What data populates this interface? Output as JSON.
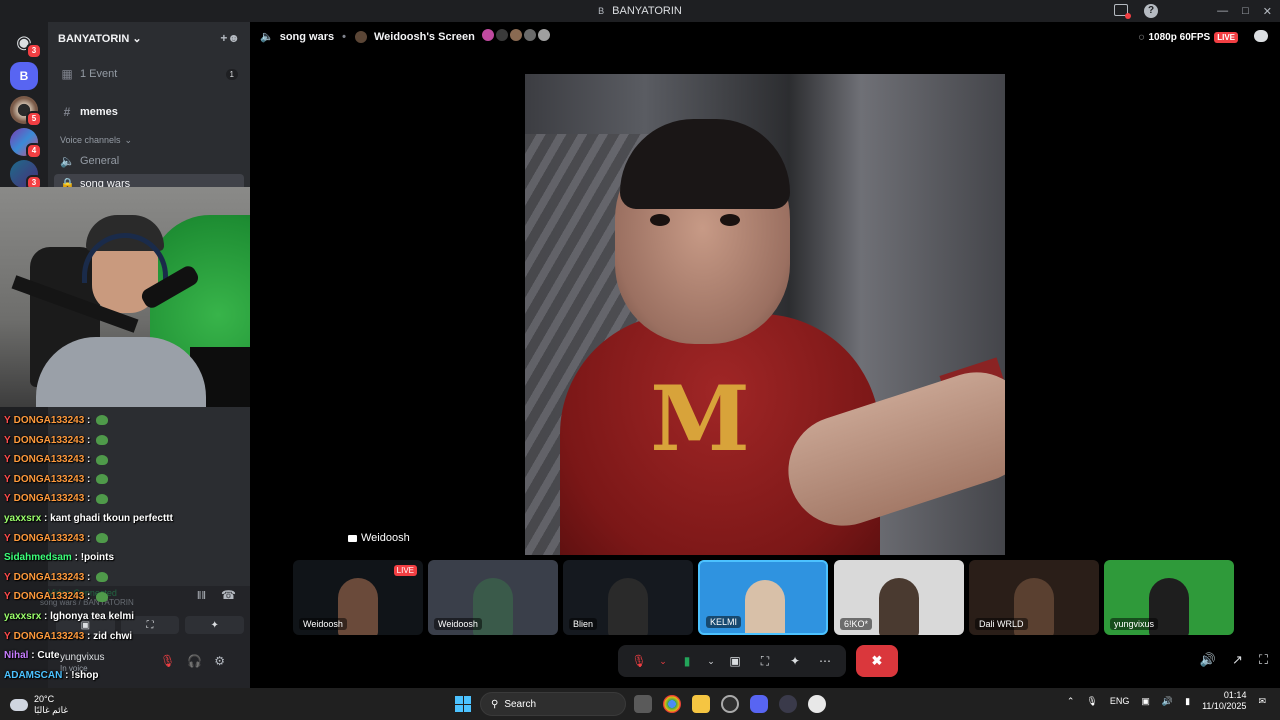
{
  "window": {
    "badge": "B",
    "title": "BANYATORIN"
  },
  "rail": {
    "items": [
      {
        "label": "B",
        "badge": ""
      },
      {
        "label": "",
        "badge": "5"
      },
      {
        "label": "",
        "badge": "4"
      },
      {
        "label": "",
        "badge": "3"
      }
    ],
    "discord_badge": "3"
  },
  "server": {
    "name": "BANYATORIN",
    "events": {
      "label": "1 Event",
      "count": "1"
    },
    "text_channel": "memes",
    "voice_header": "Voice channels",
    "voice_channels": [
      "General",
      "song wars"
    ]
  },
  "chat": [
    {
      "user": "DONGA133243",
      "msg": "",
      "color": "#ff9a3c",
      "emote": true
    },
    {
      "user": "DONGA133243",
      "msg": "",
      "color": "#ff9a3c",
      "emote": true
    },
    {
      "user": "DONGA133243",
      "msg": "",
      "color": "#ff9a3c",
      "emote": true
    },
    {
      "user": "DONGA133243",
      "msg": "",
      "color": "#ff9a3c",
      "emote": true
    },
    {
      "user": "DONGA133243",
      "msg": "",
      "color": "#ff9a3c",
      "emote": true
    },
    {
      "user": "yaxxsrx",
      "msg": "kant ghadi tkoun perfecttt",
      "color": "#9aff6b",
      "emote": false
    },
    {
      "user": "DONGA133243",
      "msg": "",
      "color": "#ff9a3c",
      "emote": true
    },
    {
      "user": "Sidahmedsam",
      "msg": "!points",
      "color": "#3cff7a",
      "emote": false
    },
    {
      "user": "DONGA133243",
      "msg": "",
      "color": "#ff9a3c",
      "emote": true
    },
    {
      "user": "DONGA133243",
      "msg": "",
      "color": "#ff9a3c",
      "emote": true
    },
    {
      "user": "yaxxsrx",
      "msg": "lghonya tea kelmi",
      "color": "#9aff6b",
      "emote": false
    },
    {
      "user": "DONGA133243",
      "msg": "zid chwi",
      "color": "#ff9a3c",
      "emote": false
    },
    {
      "user": "Nihal",
      "msg": "Cute",
      "color": "#c77dff",
      "emote": false
    },
    {
      "user": "ADAMSCAN",
      "msg": "!shop",
      "color": "#4cc2ff",
      "emote": false
    }
  ],
  "voice_panel": {
    "status": "Video Connected",
    "channel": "song wars / BANYATORIN",
    "user": "yungvixus",
    "user_status": "In voice"
  },
  "stage": {
    "channel": "song wars",
    "screen_title": "Weidoosh's Screen",
    "quality": "1080p 60FPS",
    "live": "LIVE",
    "sharer": "Weidoosh"
  },
  "tiles": [
    {
      "name": "Weidoosh",
      "live": "LIVE",
      "bg": "#101418"
    },
    {
      "name": "Weidoosh",
      "live": "",
      "bg": "#3a3f4a"
    },
    {
      "name": "Blien",
      "live": "",
      "bg": "#15191f"
    },
    {
      "name": "KELMI",
      "live": "",
      "bg": "#2f93e0"
    },
    {
      "name": "6!KO*",
      "live": "",
      "bg": "#d9d9d9"
    },
    {
      "name": "Dali WRLD",
      "live": "",
      "bg": "#2a1e18"
    },
    {
      "name": "yungvixus",
      "live": "",
      "bg": "#2f9a3a"
    }
  ],
  "taskbar": {
    "weather_temp": "20°C",
    "weather_desc": "غائم غالبًا",
    "search": "Search",
    "lang": "ENG",
    "time": "01:14",
    "date": "11/10/2025"
  },
  "icons": {
    "window_title_badge": "b-icon",
    "add_member": "add-member-icon",
    "calendar": "calendar-icon",
    "hash": "hash-icon",
    "speaker": "speaker-icon",
    "lock": "lock-icon"
  }
}
